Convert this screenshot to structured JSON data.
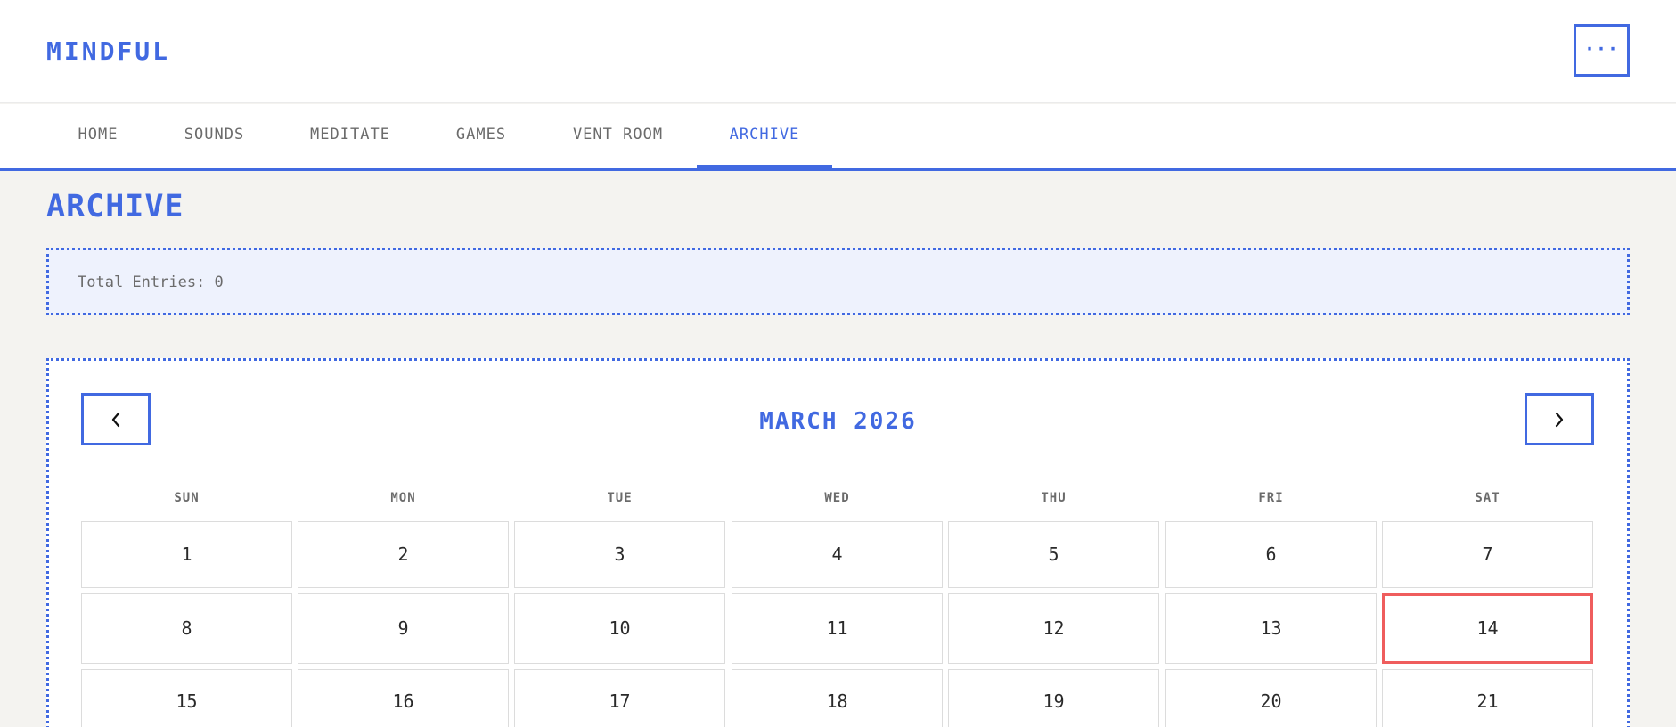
{
  "app": {
    "logo": "MINDFUL",
    "menu_label": "···"
  },
  "nav": {
    "items": [
      {
        "label": "HOME",
        "active": false
      },
      {
        "label": "SOUNDS",
        "active": false
      },
      {
        "label": "MEDITATE",
        "active": false
      },
      {
        "label": "GAMES",
        "active": false
      },
      {
        "label": "VENT ROOM",
        "active": false
      },
      {
        "label": "ARCHIVE",
        "active": true
      }
    ]
  },
  "page": {
    "title": "ARCHIVE"
  },
  "stats": {
    "total_entries": "Total Entries: 0"
  },
  "calendar": {
    "month_title": "MARCH 2026",
    "prev_icon": "chevron-left-icon",
    "next_icon": "chevron-right-icon",
    "weekdays": [
      "SUN",
      "MON",
      "TUE",
      "WED",
      "THU",
      "FRI",
      "SAT"
    ],
    "days": [
      "1",
      "2",
      "3",
      "4",
      "5",
      "6",
      "7",
      "8",
      "9",
      "10",
      "11",
      "12",
      "13",
      "14",
      "15",
      "16",
      "17",
      "18",
      "19",
      "20",
      "21"
    ],
    "highlighted_day": "14"
  },
  "colors": {
    "accent": "#4169e1",
    "today_border": "#ef5d5d",
    "background": "#f4f3f0",
    "stats_background": "#eef2fd"
  }
}
